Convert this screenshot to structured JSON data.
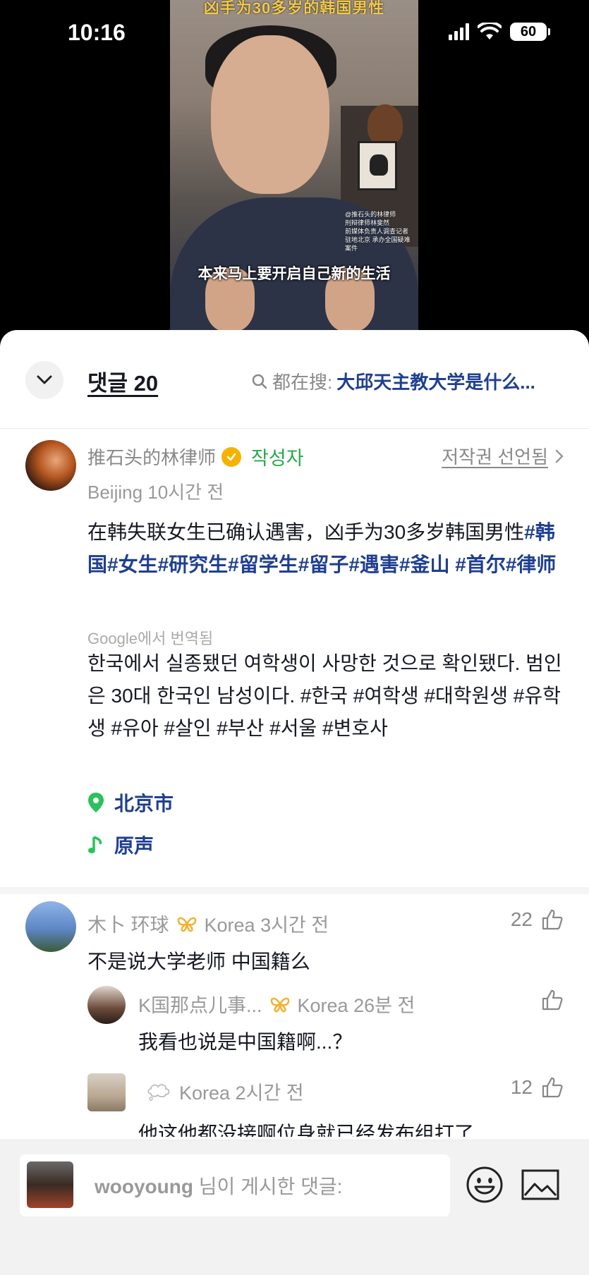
{
  "status_bar": {
    "time": "10:16",
    "battery": "60"
  },
  "video": {
    "top_title": "凶手为30多岁的韩国男性",
    "caption": "本来马上要开启自己新的生活",
    "watermark_lines": [
      "@推石头的林律师",
      "刑辩律师林斐然",
      "前媒体负责人调查记者",
      "驻地北京 承办全国疑难案件"
    ]
  },
  "header": {
    "comment_count_label": "댓글 20",
    "search_prefix": "都在搜:",
    "search_query": "大邱天主教大学是什么..."
  },
  "post": {
    "author": "推石头的林律师",
    "author_badge": "작성자",
    "copyright": "저작권 선언됨",
    "meta": "Beijing 10시간 전",
    "text_plain": "在韩失联女生已确认遇害，凶手为30多岁韩国男性",
    "hashtags": [
      "#韩国",
      "#女生",
      "#研究生",
      "#留学生",
      "#留子",
      "#遇害",
      "#釜山",
      "#首尔",
      "#律师"
    ],
    "translated_by": "Google에서 번역됨",
    "translation": "한국에서 실종됐던 여학생이 사망한 것으로 확인됐다. 범인은 30대 한국인 남성이다. #한국 #여학생 #대학원생 #유학생 #유아 #살인 #부산 #서울 #변호사",
    "location": "北京市",
    "sound": "原声"
  },
  "comments": [
    {
      "name": "木卜 环球",
      "meta": "Korea 3시간 전",
      "text": "不是说大学老师 中国籍么",
      "likes": "22"
    },
    {
      "name": "K国那点儿事...",
      "meta": "Korea 26분 전",
      "text": "我看也说是中国籍啊...？",
      "likes": ""
    },
    {
      "name": "",
      "meta": "Korea 2시간 전",
      "text": "他这他都没接啊位身就已经发布组打了",
      "likes": "12"
    }
  ],
  "input": {
    "placeholder_user": "wooyoung",
    "placeholder_rest": " 님이 게시한 댓글:"
  },
  "colors": {
    "link_blue": "#1f3f8f",
    "verified_gold": "#f5b301",
    "author_green": "#2aa84a"
  }
}
